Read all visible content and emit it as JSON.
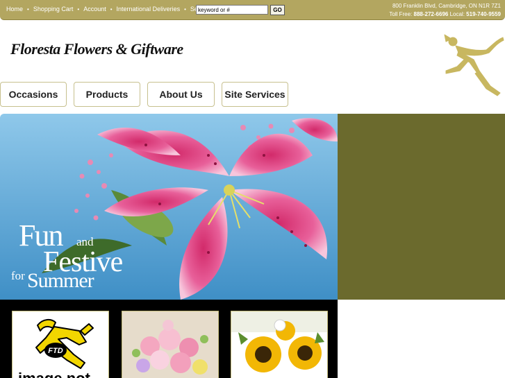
{
  "topnav": {
    "home": "Home",
    "cart": "Shopping Cart",
    "account": "Account",
    "international": "International Deliveries",
    "search_label": "Search",
    "search_value": "keyword or #",
    "go": "GO"
  },
  "contact": {
    "address": "800 Franklin Blvd, Cambridge, ON N1R 7Z1",
    "tollfree_label": "Toll Free:",
    "tollfree": "888-272-6696",
    "local_label": "Local:",
    "local": "519-740-9559"
  },
  "logo": {
    "name": "Floresta Flowers & Giftware"
  },
  "tabs": [
    {
      "label": "Occasions"
    },
    {
      "label": "Products"
    },
    {
      "label": "About Us"
    },
    {
      "label": "Site Services"
    }
  ],
  "promo": {
    "line1": "Fun",
    "and": "and",
    "line2": "Festive",
    "for": "for",
    "line3": "Summer"
  },
  "products": [
    {
      "image": "ftd-image-not-available",
      "caption": "image not"
    },
    {
      "image": "pink-bouquet"
    },
    {
      "image": "sunflower-bouquet"
    }
  ],
  "colors": {
    "topbar": "#b3a660",
    "side_panel": "#6b6a2d",
    "tab_border": "#c7c08e"
  }
}
